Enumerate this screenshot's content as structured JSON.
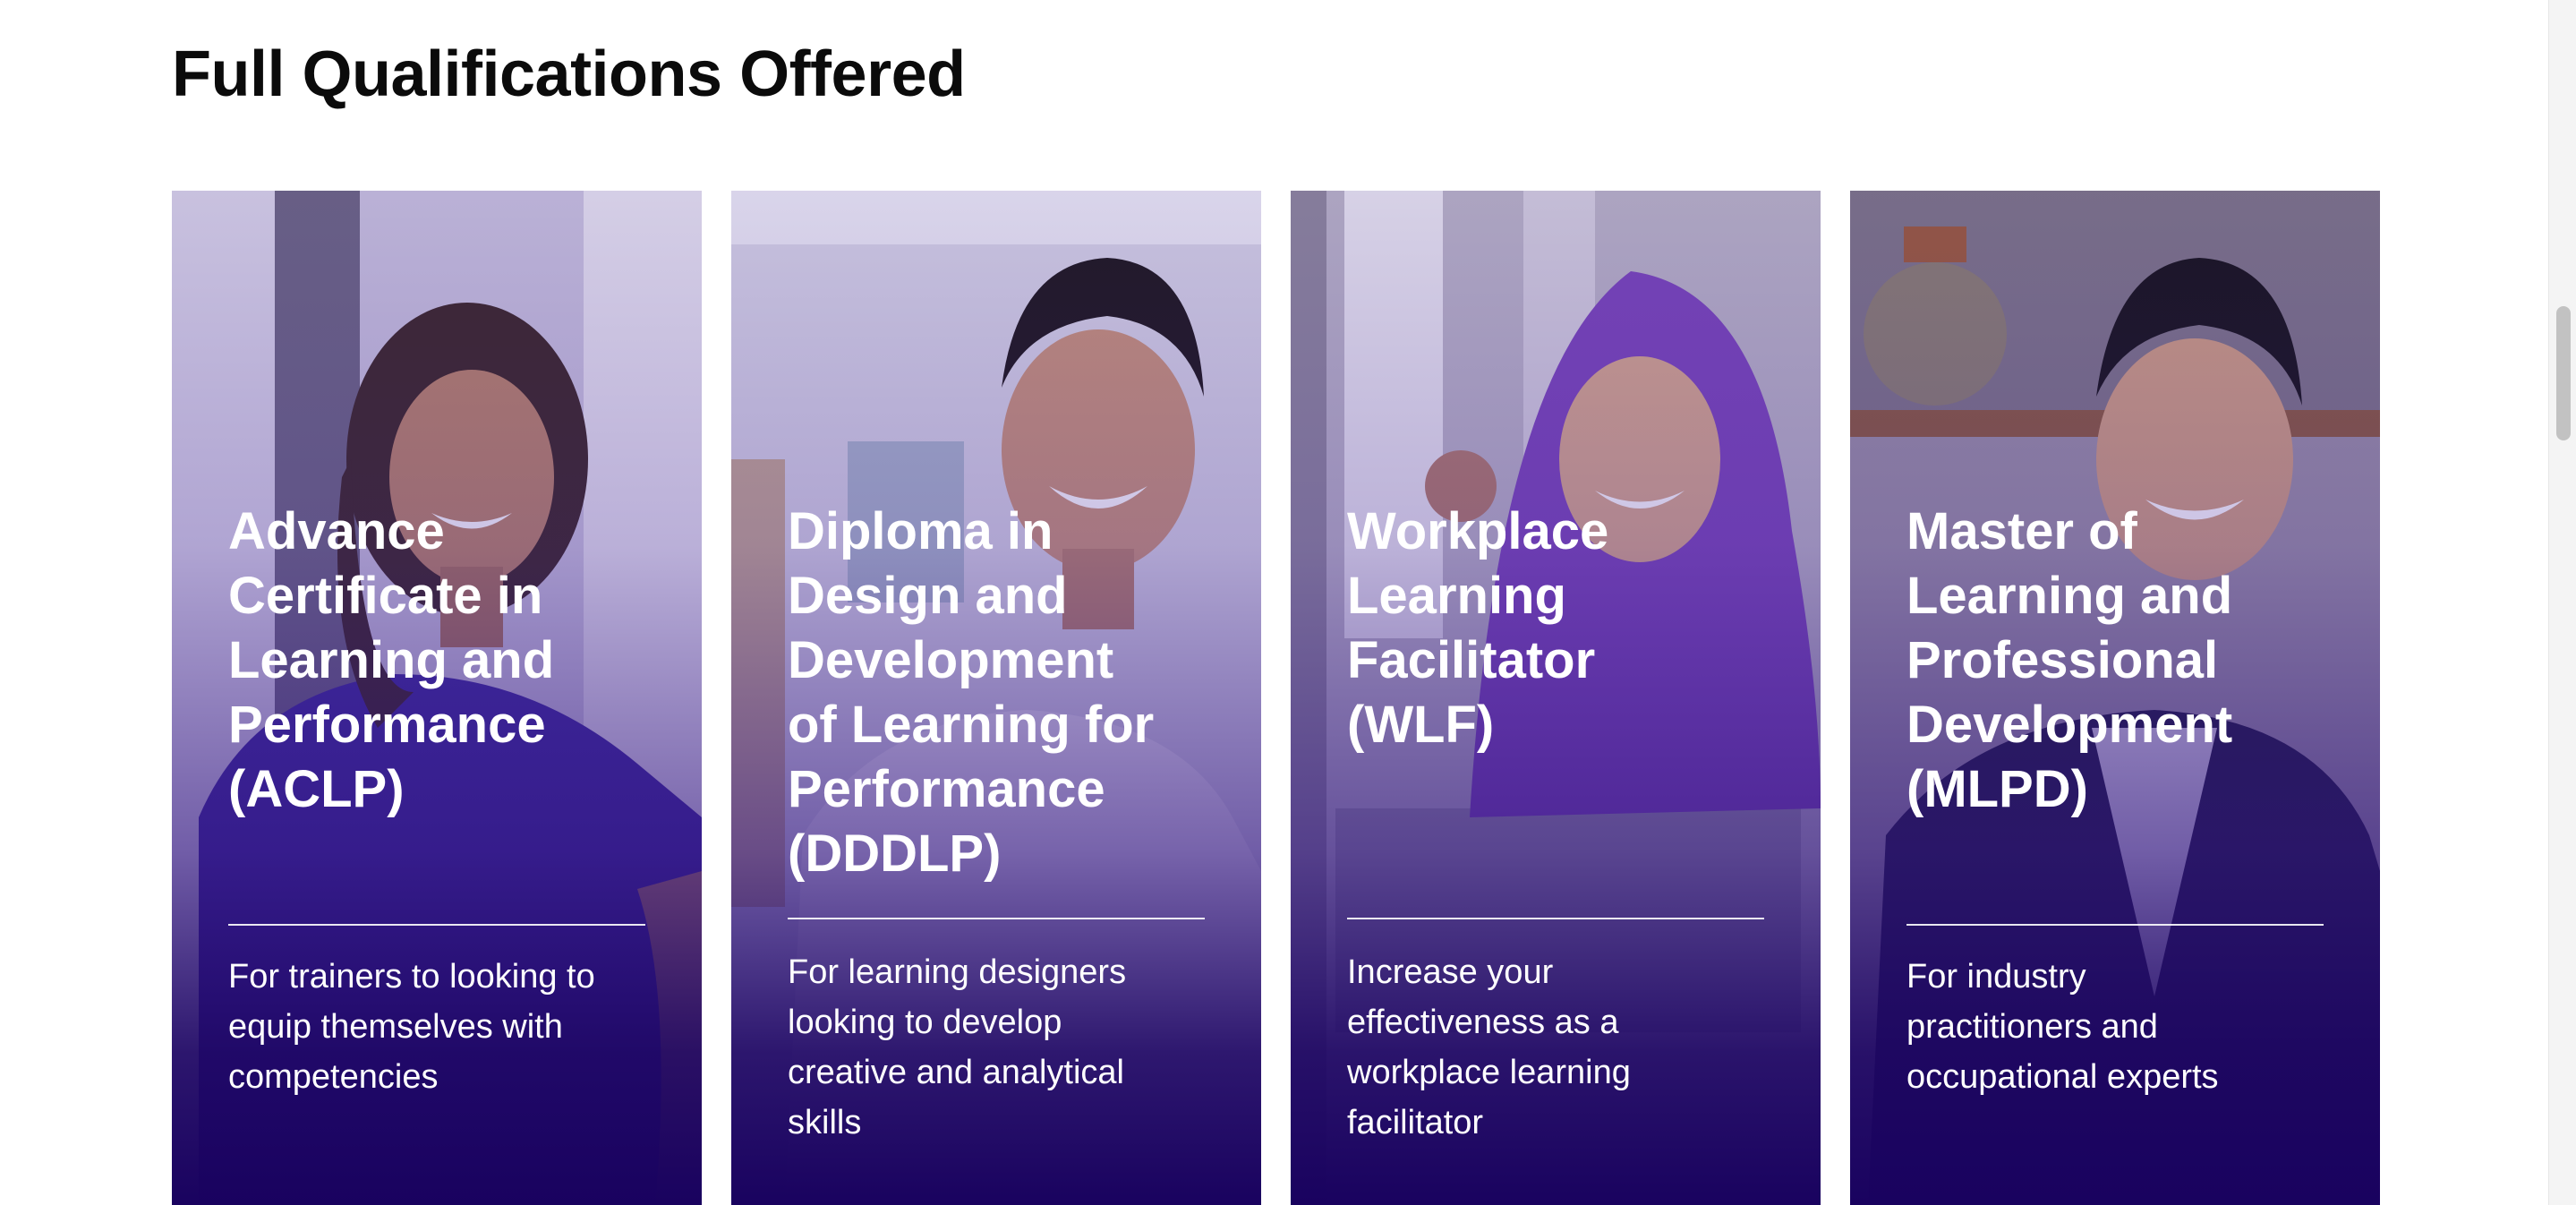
{
  "section": {
    "title": "Full Qualifications Offered"
  },
  "cards": [
    {
      "title": "Advance\nCertificate in\nLearning and\nPerformance\n(ACLP)",
      "description": "For trainers to looking to\nequip themselves with\ncompetencies"
    },
    {
      "title": "Diploma in\nDesign and\nDevelopment\nof Learning for\nPerformance\n(DDDLP)",
      "description": "For learning designers\nlooking to develop\ncreative and analytical\nskills"
    },
    {
      "title": "Workplace\nLearning\nFacilitator\n(WLF)",
      "description": "Increase your\neffectiveness as a\nworkplace learning\nfacilitator"
    },
    {
      "title": "Master of\nLearning and\nProfessional\nDevelopment\n(MLPD)",
      "description": "For industry\npractitioners and\noccupational experts"
    }
  ],
  "colors": {
    "overlay_dark": "#19025f",
    "overlay_mid": "#4a2aa8",
    "text": "#ffffff",
    "heading": "#0b0b0b"
  }
}
